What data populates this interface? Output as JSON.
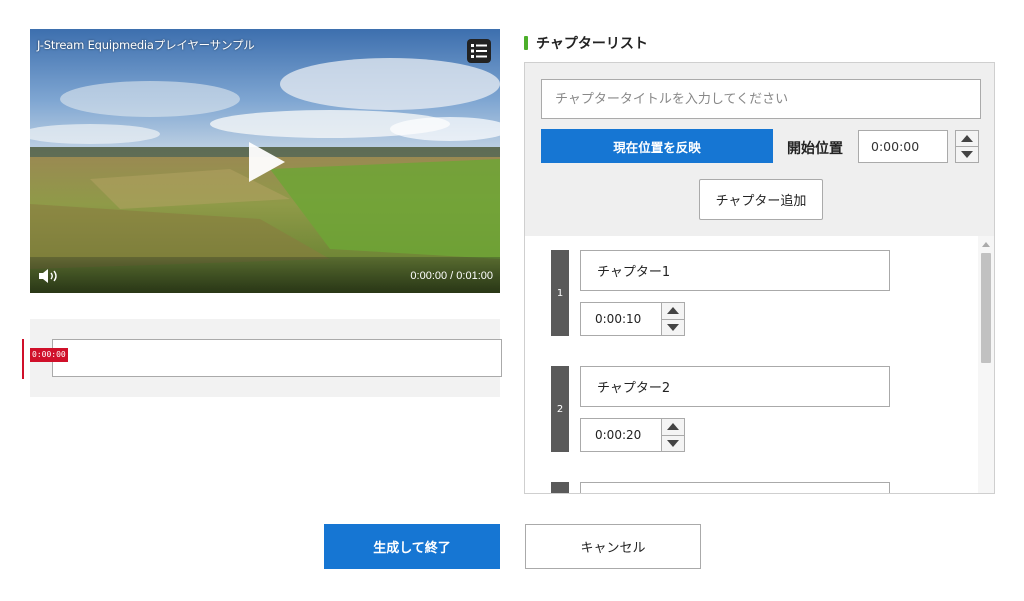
{
  "player": {
    "video_title": "J-Stream Equipmediaプレイヤーサンプル",
    "time_display": "0:00:00 / 0:01:00",
    "icons": {
      "chapter_menu": "list-icon",
      "play": "play-icon",
      "volume": "volume-icon"
    }
  },
  "timeline": {
    "playhead_time": "0:00:00",
    "playhead_color": "#d0102a"
  },
  "chapters": {
    "section_title": "チャプターリスト",
    "title_placeholder": "チャプタータイトルを入力してください",
    "reflect_button": "現在位置を反映",
    "start_label": "開始位置",
    "start_time": "0:00:00",
    "add_button": "チャプター追加",
    "items": [
      {
        "number": "1",
        "title": "チャプター1",
        "time": "0:00:10"
      },
      {
        "number": "2",
        "title": "チャプター2",
        "time": "0:00:20"
      },
      {
        "number": "",
        "title": "",
        "time": ""
      }
    ]
  },
  "footer": {
    "generate_button": "生成して終了",
    "cancel_button": "キャンセル"
  },
  "colors": {
    "primary_blue": "#1676d3",
    "section_marker_green": "#4caf2a",
    "chapter_bar_gray": "#5a5a5a"
  }
}
